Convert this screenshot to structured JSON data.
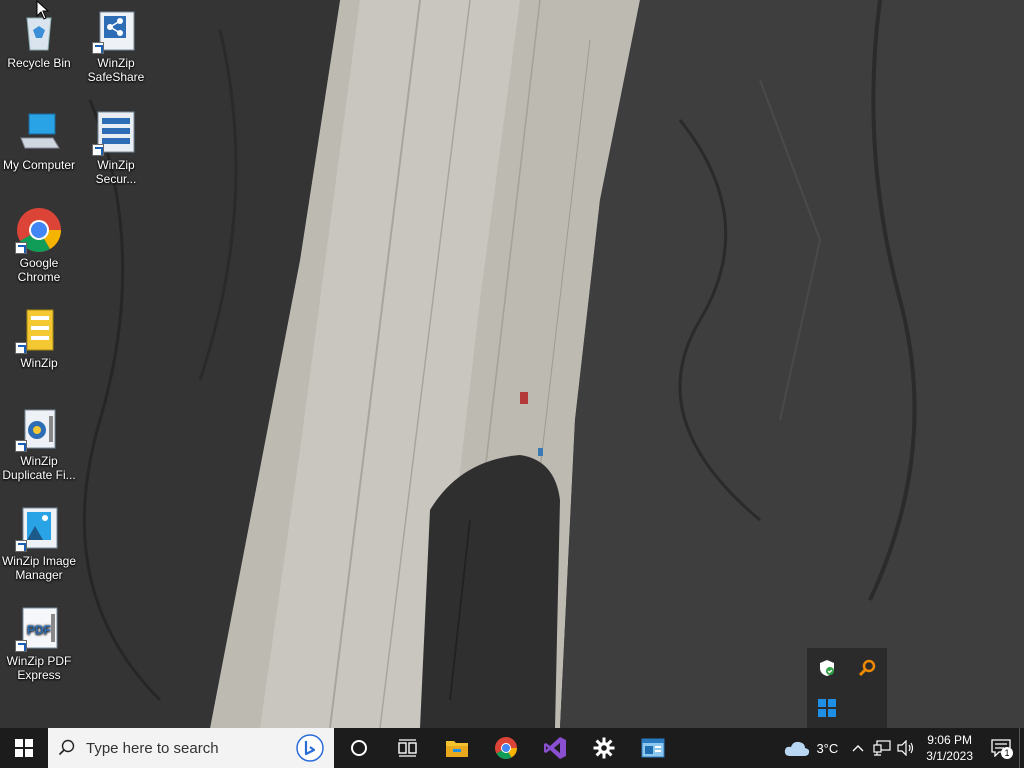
{
  "desktop": {
    "icons": [
      {
        "label": "Recycle Bin"
      },
      {
        "label": "WinZip SafeShare"
      },
      {
        "label": "My Computer"
      },
      {
        "label": "WinZip Secur..."
      },
      {
        "label": "Google Chrome"
      },
      {
        "label": "WinZip"
      },
      {
        "label": "WinZip Duplicate Fi..."
      },
      {
        "label": "WinZip Image Manager"
      },
      {
        "label": "WinZip PDF Express"
      }
    ]
  },
  "tray_popup": {
    "icons": [
      "security-shield-icon",
      "search-magnifier-icon",
      "windows-logo-icon"
    ]
  },
  "taskbar": {
    "search_placeholder": "Type here to search",
    "pinned": [
      "cortana-icon",
      "task-view-icon",
      "file-explorer-icon",
      "chrome-icon",
      "visual-studio-icon",
      "settings-gear-icon",
      "app-window-icon"
    ],
    "weather": {
      "temp": "3°C",
      "icon": "cloud-icon"
    },
    "clock": {
      "time": "9:06 PM",
      "date": "3/1/2023"
    },
    "notifications": {
      "count": "1"
    }
  },
  "colors": {
    "taskbar_bg": "#1c1c1c",
    "search_bg": "#f3f3f3",
    "accent_blue": "#0078d4"
  }
}
